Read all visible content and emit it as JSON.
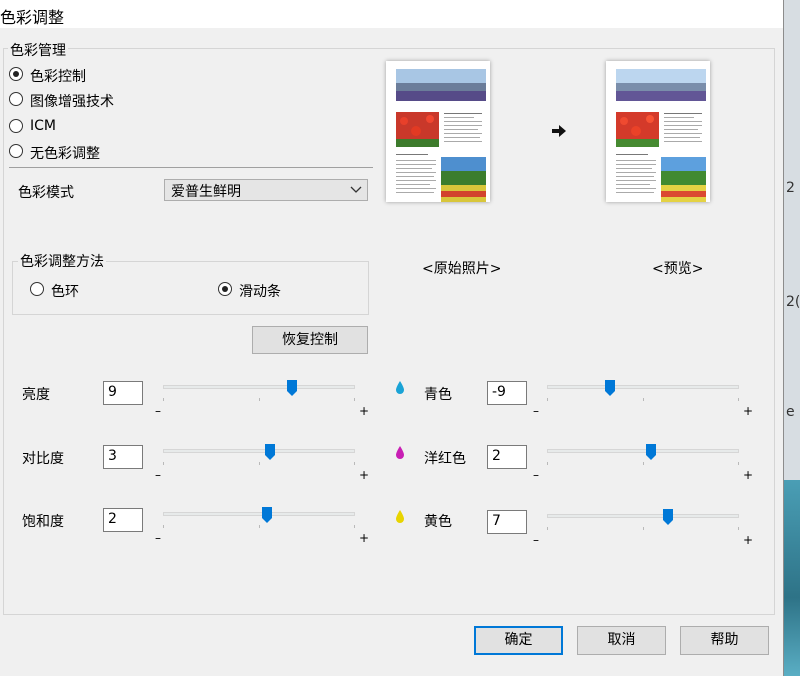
{
  "window": {
    "title": "色彩调整"
  },
  "color_management": {
    "group_title": "色彩管理",
    "options": [
      {
        "label": "色彩控制",
        "selected": true
      },
      {
        "label": "图像增强技术",
        "selected": false
      },
      {
        "label": "ICM",
        "selected": false
      },
      {
        "label": "无色彩调整",
        "selected": false
      }
    ]
  },
  "color_mode": {
    "label": "色彩模式",
    "value": "爱普生鲜明"
  },
  "adjust_method": {
    "group_title": "色彩调整方法",
    "options": [
      {
        "label": "色环",
        "selected": false
      },
      {
        "label": "滑动条",
        "selected": true
      }
    ]
  },
  "preview": {
    "original_label": "<原始照片>",
    "preview_label": "<预览>"
  },
  "reset_button": "恢复控制",
  "sliders_left": [
    {
      "label": "亮度",
      "value": "9"
    },
    {
      "label": "对比度",
      "value": "3"
    },
    {
      "label": "饱和度",
      "value": "2"
    }
  ],
  "sliders_right": [
    {
      "label": "青色",
      "value": "-9",
      "icon": "cyan-drop-icon",
      "color": "#1aa3d6"
    },
    {
      "label": "洋红色",
      "value": "2",
      "icon": "magenta-drop-icon",
      "color": "#c81fb4"
    },
    {
      "label": "黄色",
      "value": "7",
      "icon": "yellow-drop-icon",
      "color": "#e8d400"
    }
  ],
  "slider_range_labels": {
    "min": "–",
    "max": "+"
  },
  "footer": {
    "ok": "确定",
    "cancel": "取消",
    "help": "帮助"
  },
  "background_glyphs": [
    "2(",
    "e",
    "2"
  ]
}
